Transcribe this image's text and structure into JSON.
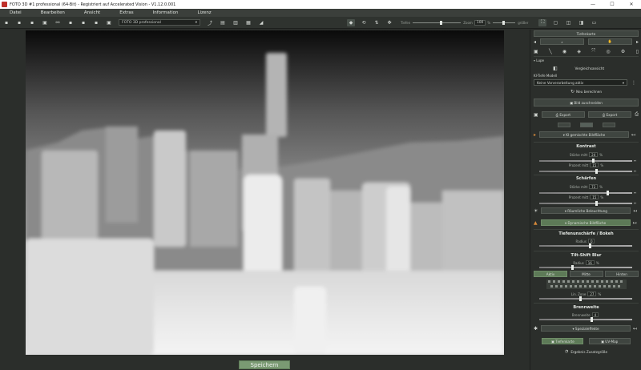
{
  "window": {
    "title": "FOTO 3D #1 professional (64-Bit) - Registriert auf Accelerated Vision - V1.12.0.001",
    "minimize": "—",
    "maximize": "☐",
    "close": "✕"
  },
  "menu": [
    "Datei",
    "Bearbeiten",
    "Ansicht",
    "Extras",
    "Information",
    "Lizenz"
  ],
  "toolbar": {
    "preset_value": "FOTO 3D professional",
    "slider_left_label": "Tiefen",
    "slider_right_label": "größer",
    "zoom_prefix": "Zoom",
    "zoom_value": "100",
    "zoom_unit": "%"
  },
  "bottom": {
    "save_label": "Speichern"
  },
  "panel": {
    "tab_top": "Tiefenkarte",
    "lupe": "Lupe",
    "vergleich": "Vergleichsansicht",
    "ki_header": "KI-Tiefe Modell",
    "ki_model": "Keine Vorverarbeitung aktiv",
    "neu_berechnen": "Neu berechnen",
    "bild_zuschneiden": "Bild zuschneiden",
    "export1": "Export",
    "export2": "Export",
    "kontrast_dropdown": "KI gemischte Bildfläche",
    "kontrast": "Kontrast",
    "staerke1_label": "Stärke mitt",
    "staerke1_value": "24",
    "prozent_label": "Prozent mitt",
    "prozent_value": "15",
    "unit_pct": "%",
    "schaerfen": "Schärfen",
    "schaerfen_a_label": "Stärke mitt",
    "schaerfen_a_value": "72",
    "schaerfen_b_label": "Prozent mitt",
    "schaerfen_b_value": "15",
    "raeumliche": "Räumliche Beleuchtung",
    "dynamic": "Dynamische Bildfläche",
    "tiefen": "Tiefenunschärfe / Bokeh",
    "radius_label": "Radius",
    "radius_value": "0",
    "tilt": "Tilt-Shift Blur",
    "tilt_radius_label": "Radius",
    "tilt_radius_value": "16",
    "mode_a": "Aktiv",
    "mode_b": "Mitte",
    "mode_c": "Hinten",
    "lin_label": "Lin. Zone",
    "lin_value": "27",
    "brennweite": "Brennweite",
    "brenn_label": "Brennweite",
    "brenn_value": "4",
    "spezial": "Spezialeffekte",
    "speichern_btn": "Tiefenkarte",
    "uv_btn": "UV-Map",
    "ergebnis": "Ergebnis Zusatzgröße"
  },
  "colors": {
    "accent": "#5d7a57",
    "save": "#7a9a73",
    "bg": "#2b2e2b"
  }
}
